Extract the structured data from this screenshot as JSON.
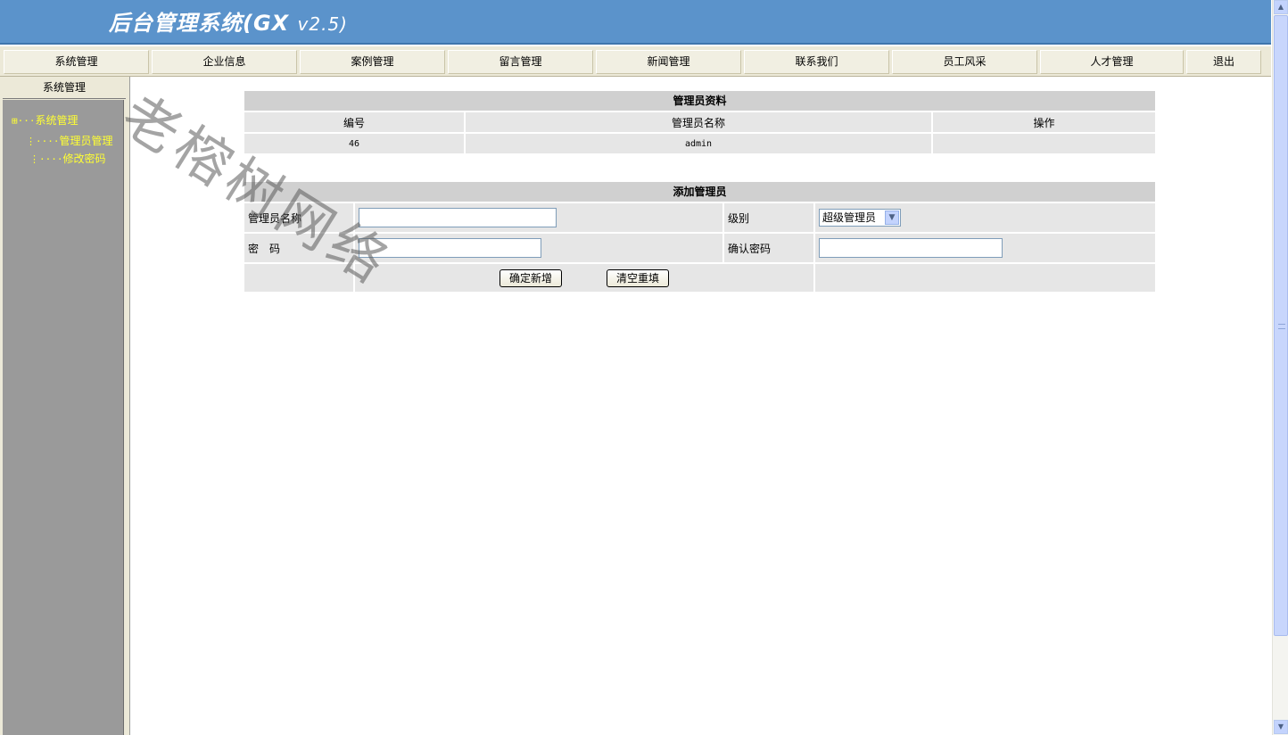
{
  "header": {
    "title": "后台管理系统(GX",
    "version": "v2.5)"
  },
  "nav": [
    {
      "label": "系统管理"
    },
    {
      "label": "企业信息"
    },
    {
      "label": "案例管理"
    },
    {
      "label": "留言管理"
    },
    {
      "label": "新闻管理"
    },
    {
      "label": "联系我们"
    },
    {
      "label": "员工风采"
    },
    {
      "label": "人才管理"
    },
    {
      "label": "退出"
    }
  ],
  "sidebar": {
    "heading": "系统管理",
    "tree": {
      "root": "系统管理",
      "children": [
        {
          "label": "管理员管理"
        },
        {
          "label": "修改密码"
        }
      ]
    }
  },
  "admin_table": {
    "title": "管理员资料",
    "columns": [
      "编号",
      "管理员名称",
      "操作"
    ],
    "rows": [
      {
        "id": "46",
        "name": "admin",
        "action": ""
      }
    ]
  },
  "add_form": {
    "title": "添加管理员",
    "name_label": "管理员名称",
    "name_value": "",
    "level_label": "级别",
    "level_selected": "超级管理员",
    "password_label": "密　码",
    "password_value": "",
    "confirm_label": "确认密码",
    "confirm_value": "",
    "submit_label": "确定新增",
    "reset_label": "清空重填"
  },
  "watermark": "老榕树网络",
  "colors": {
    "header_bg": "#5b93cb",
    "sidebar_bg": "#9a9a9a",
    "tree_text": "#ffff33",
    "cell_bg": "#e6e6e6"
  }
}
